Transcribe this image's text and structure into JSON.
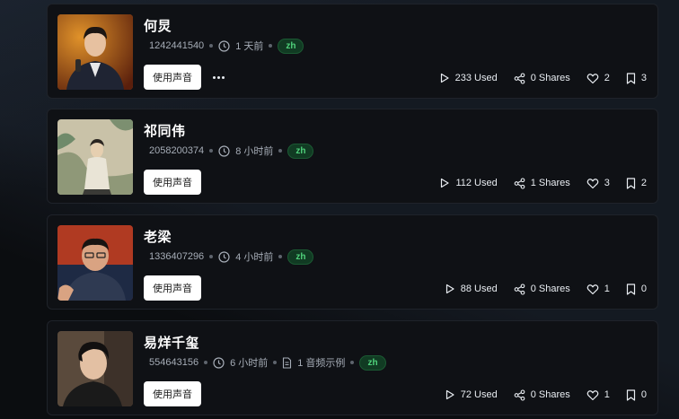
{
  "voices": [
    {
      "name": "何炅",
      "id": "1242441540",
      "time": "1 天前",
      "samples": "",
      "lang": "zh",
      "use_label": "使用声音",
      "has_more": true,
      "used": "233 Used",
      "shares": "0 Shares",
      "likes": "2",
      "saves": "3"
    },
    {
      "name": "祁同伟",
      "id": "2058200374",
      "time": "8 小时前",
      "samples": "",
      "lang": "zh",
      "use_label": "使用声音",
      "has_more": false,
      "used": "112 Used",
      "shares": "1 Shares",
      "likes": "3",
      "saves": "2"
    },
    {
      "name": "老梁",
      "id": "1336407296",
      "time": "4 小时前",
      "samples": "",
      "lang": "zh",
      "use_label": "使用声音",
      "has_more": false,
      "used": "88 Used",
      "shares": "0 Shares",
      "likes": "1",
      "saves": "0"
    },
    {
      "name": "易烊千玺",
      "id": "554643156",
      "time": "6 小时前",
      "samples": "1 音频示例",
      "lang": "zh",
      "use_label": "使用声音",
      "has_more": false,
      "used": "72 Used",
      "shares": "0 Shares",
      "likes": "1",
      "saves": "0"
    }
  ],
  "icons": {
    "time": "clock-icon",
    "samples": "file-icon",
    "used": "play-icon",
    "shares": "share-icon",
    "likes": "heart-icon",
    "saves": "bookmark-icon",
    "more": "more-horizontal-icon"
  },
  "colors": {
    "background": "#0b0d10",
    "card": "#0f1115",
    "lang_badge_bg": "#113b23",
    "lang_badge_text": "#4fd27b",
    "button_bg": "#ffffff"
  }
}
